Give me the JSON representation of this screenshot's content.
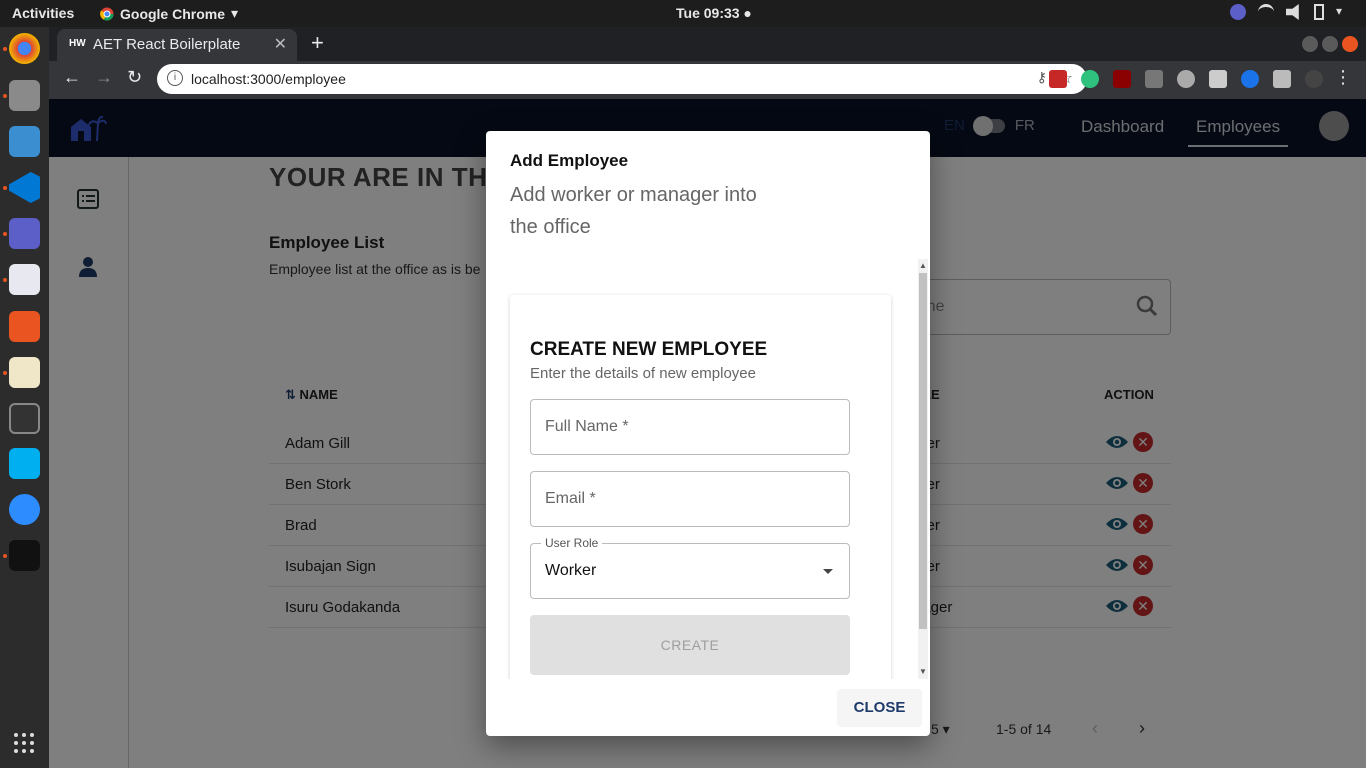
{
  "system": {
    "activities": "Activities",
    "app_menu": "Google Chrome",
    "clock": "Tue 09:33"
  },
  "browser": {
    "tab_title": "AET React Boilerplate",
    "tab_favicon": "HW",
    "url": "localhost:3000/employee"
  },
  "header": {
    "lang_en": "EN",
    "lang_fr": "FR",
    "nav": [
      {
        "label": "Dashboard"
      },
      {
        "label": "Employees"
      }
    ]
  },
  "page": {
    "title": "YOUR ARE IN TH",
    "list_title": "Employee List",
    "list_subtitle": "Employee list at the office as is be",
    "search_placeholder": "y name"
  },
  "table": {
    "headers": {
      "name": "NAME",
      "role": "LE",
      "action": "ACTION"
    },
    "rows": [
      {
        "name": "Adam Gill",
        "role": "rker"
      },
      {
        "name": "Ben Stork",
        "role": "rker"
      },
      {
        "name": "Brad",
        "role": "rker"
      },
      {
        "name": "Isubajan Sign",
        "role": "rker"
      },
      {
        "name": "Isuru Godakanda",
        "role": "nager"
      }
    ]
  },
  "pagination": {
    "rows_per_page": "5",
    "range": "1-5 of 14"
  },
  "dialog": {
    "title": "Add Employee",
    "text": "Add worker or manager into the office",
    "card_title": "CREATE NEW EMPLOYEE",
    "card_subtitle": "Enter the details of new employee",
    "full_name_placeholder": "Full Name *",
    "email_placeholder": "Email *",
    "role_label": "User Role",
    "role_value": "Worker",
    "create_label": "CREATE",
    "close_label": "CLOSE"
  },
  "colors": {
    "appbar": "#0b1227",
    "primary": "#1e3a6b",
    "eye": "#1b5e7a",
    "delete": "#c62828"
  }
}
